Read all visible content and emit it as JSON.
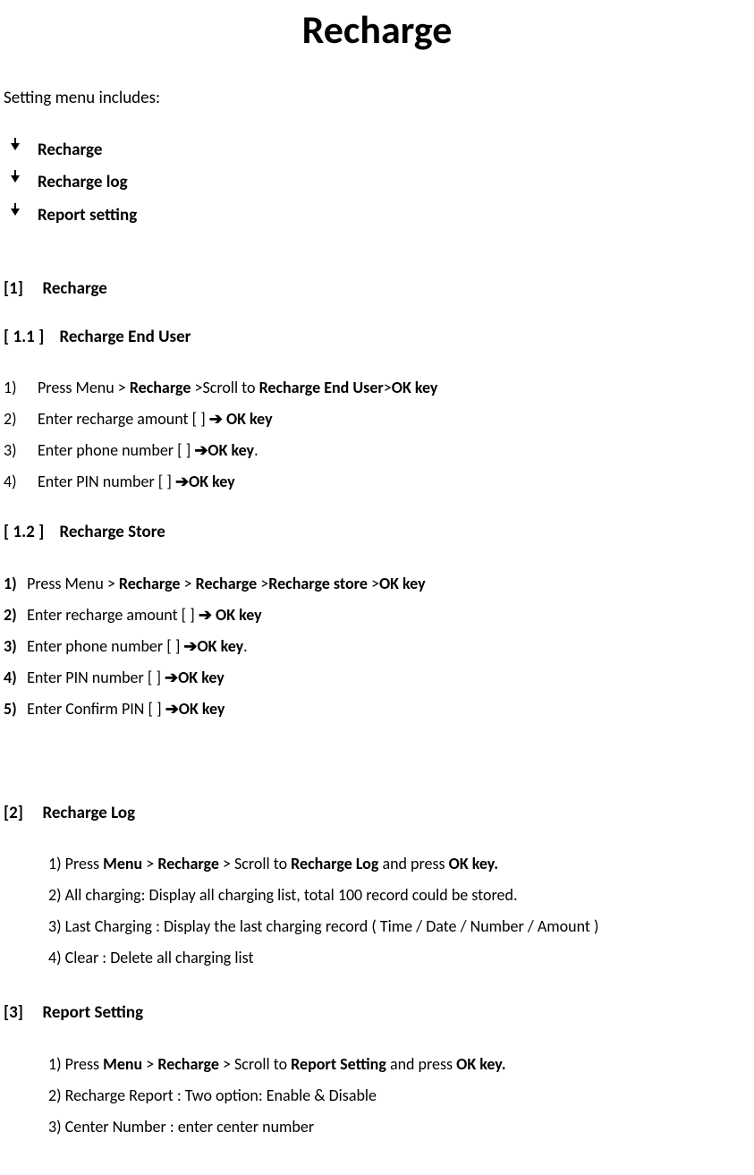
{
  "title": "Recharge",
  "intro": "Setting menu includes:",
  "bullets": [
    "Recharge",
    "Recharge log",
    "Report setting"
  ],
  "section1": {
    "header_num": "[1]",
    "header_text": "Recharge",
    "sub1": {
      "num": "[ 1.1 ]",
      "text": "Recharge End User",
      "steps": {
        "n1": "1)",
        "n2": "2)",
        "n3": "3)",
        "n4": "4)",
        "s1a": "Press Menu > ",
        "s1b": "Recharge",
        "s1c": " >Scroll to ",
        "s1d": "Recharge End User",
        "s1e": ">",
        "s1f": "OK key",
        "s2a": "Enter recharge amount   [       ] ",
        "s2b": "➔ OK key",
        "s3a": "Enter phone number [       ] ",
        "s3b": "➔OK key",
        "s3c": ".",
        "s4a": "Enter PIN number [       ] ",
        "s4b": "➔OK key"
      }
    },
    "sub2": {
      "num": "[ 1.2 ]",
      "text": "Recharge Store",
      "steps": {
        "n1": "1)",
        "n2": "2)",
        "n3": "3)",
        "n4": "4)",
        "n5": "5)",
        "s1a": " Press Menu > ",
        "s1b": "Recharge",
        "s1c": " > ",
        "s1d": "Recharge",
        "s1e": " >",
        "s1f": "Recharge store",
        "s1g": " >",
        "s1h": "OK key",
        "s2a": " Enter recharge amount   [       ] ",
        "s2b": "➔ OK key",
        "s3a": " Enter phone number [       ] ",
        "s3b": "➔OK key",
        "s3c": ".",
        "s4a": " Enter PIN number [    ] ",
        "s4b": "➔OK key",
        "s5a": " Enter Confirm PIN [       ] ",
        "s5b": "➔OK key"
      }
    }
  },
  "section2": {
    "header_num": "[2]",
    "header_text": "Recharge Log",
    "steps": {
      "s1a": "1) Press ",
      "s1b": "Menu",
      "s1c": " > ",
      "s1d": "Recharge",
      "s1e": " > Scroll to ",
      "s1f": "Recharge Log",
      "s1g": " and press ",
      "s1h": "OK key.",
      "s2": "2) All charging: Display all charging list, total 100 record could be stored.",
      "s3": "3) Last Charging : Display the last charging record ( Time / Date / Number / Amount )",
      "s4": "4) Clear : Delete all charging list"
    }
  },
  "section3": {
    "header_num": "[3]",
    "header_text": "Report Setting",
    "steps": {
      "s1a": "1) Press ",
      "s1b": "Menu",
      "s1c": " > ",
      "s1d": "Recharge",
      "s1e": " > Scroll to ",
      "s1f": "Report Setting",
      "s1g": " and press ",
      "s1h": "OK key.",
      "s2": "2) Recharge Report : Two option: Enable & Disable",
      "s3": "3) Center Number : enter center number"
    }
  }
}
